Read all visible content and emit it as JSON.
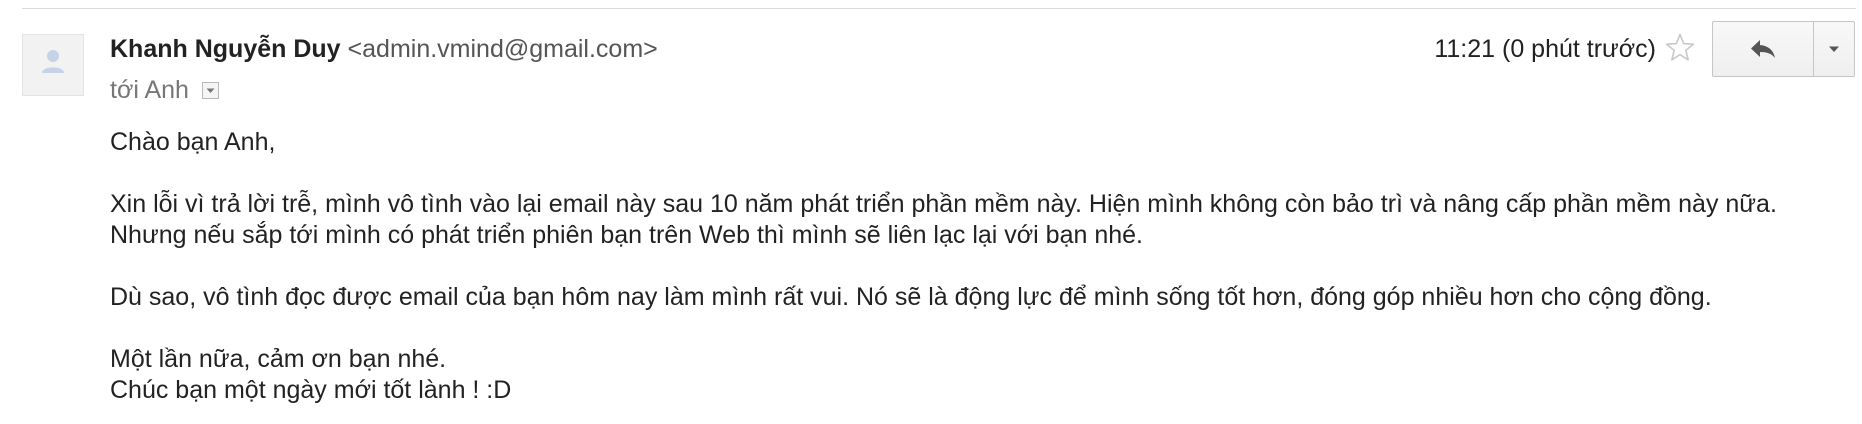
{
  "header": {
    "sender_name": "Khanh Nguyễn Duy",
    "sender_email": "<admin.vmind@gmail.com>",
    "recipient": "tới Anh",
    "time": "11:21 (0 phút trước)"
  },
  "icons": {
    "avatar": "person-icon",
    "details": "chevron-down-icon",
    "star": "star-icon",
    "reply": "reply-icon",
    "more": "caret-down-icon"
  },
  "body": {
    "greeting": "Chào bạn Anh,",
    "paragraph1": "Xin lỗi vì trả lời trễ, mình vô tình vào lại email này sau 10 năm phát triển phần mềm này. Hiện mình không còn bảo trì và nâng cấp phần mềm này nữa. Nhưng nếu sắp tới mình có phát triển phiên bạn trên Web thì mình sẽ liên lạc lại với bạn nhé.",
    "paragraph2": "Dù sao, vô tình đọc được email của bạn hôm nay làm mình rất vui. Nó sẽ là động lực để mình sống tốt hơn, đóng góp nhiều hơn cho cộng đồng.",
    "closing_line1": "Một lần nữa, cảm ơn bạn nhé.",
    "closing_line2": "Chúc bạn một ngày mới tốt lành ! :D"
  },
  "colors": {
    "avatar_bg": "#f2f2f2",
    "avatar_figure": "#c6d2e6",
    "star_outline": "#c9c9c9"
  }
}
